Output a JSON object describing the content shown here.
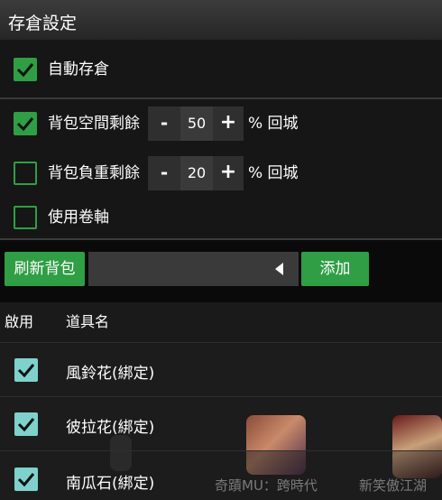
{
  "header": {
    "title": "存倉設定"
  },
  "auto_store": {
    "label": "自動存倉",
    "checked": true
  },
  "space_remain": {
    "label": "背包空間剩餘",
    "minus": "-",
    "value": "50",
    "plus": "+",
    "suffix": "% 回城",
    "checked": true
  },
  "weight_remain": {
    "label": "背包負重剩餘",
    "minus": "-",
    "value": "20",
    "plus": "+",
    "suffix": "% 回城",
    "checked": false
  },
  "use_scroll": {
    "label": "使用卷軸",
    "checked": false
  },
  "toolbar": {
    "refresh_label": "刷新背包",
    "add_label": "添加"
  },
  "table": {
    "col_enabled": "啟用",
    "col_name": "道具名",
    "rows": [
      {
        "name": "風鈴花(綁定)",
        "enabled": true
      },
      {
        "name": "彼拉花(綁定)",
        "enabled": true
      },
      {
        "name": "南瓜石(綁定)",
        "enabled": true
      }
    ]
  },
  "ads": {
    "item1": "奇蹟MU：跨時代",
    "item2": "新笑傲江湖"
  },
  "colors": {
    "accent": "#2f9e44",
    "table_check": "#7fd1cc"
  }
}
